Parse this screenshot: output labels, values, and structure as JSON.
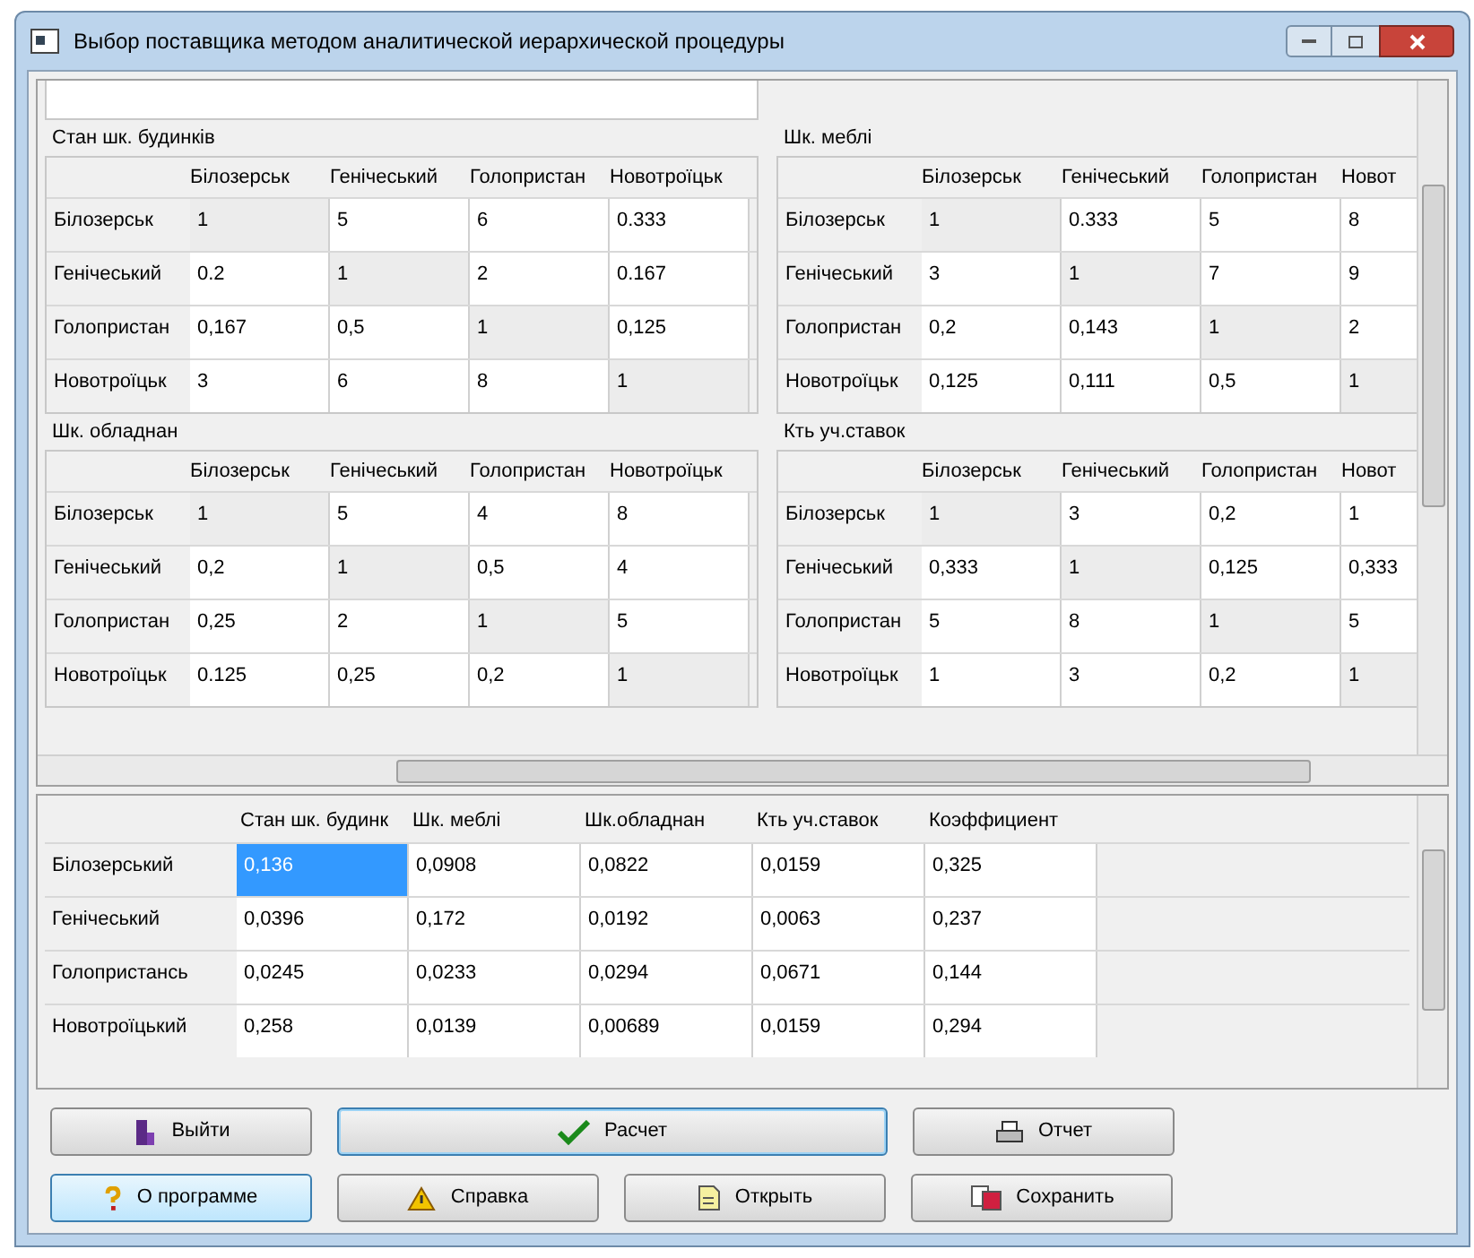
{
  "window": {
    "title": "Выбор поставщика методом аналитической иерархической процедуры"
  },
  "matrices": [
    {
      "title": "Стан шк. будинків",
      "columns": [
        "Білозерськ",
        "Генічеський",
        "Голопристан",
        "Новотроїцьк"
      ],
      "rows": [
        {
          "label": "Білозерськ",
          "cells": [
            "1",
            "5",
            "6",
            "0.333"
          ]
        },
        {
          "label": "Генічеський",
          "cells": [
            "0.2",
            "1",
            "2",
            "0.167"
          ]
        },
        {
          "label": "Голопристан",
          "cells": [
            "0,167",
            "0,5",
            "1",
            "0,125"
          ]
        },
        {
          "label": "Новотроїцьк",
          "cells": [
            "3",
            "6",
            "8",
            "1"
          ]
        }
      ]
    },
    {
      "title": "Шк. меблі",
      "columns": [
        "Білозерськ",
        "Генічеський",
        "Голопристан",
        "Новот"
      ],
      "rows": [
        {
          "label": "Білозерськ",
          "cells": [
            "1",
            "0.333",
            "5",
            "8"
          ]
        },
        {
          "label": "Генічеський",
          "cells": [
            "3",
            "1",
            "7",
            "9"
          ]
        },
        {
          "label": "Голопристан",
          "cells": [
            "0,2",
            "0,143",
            "1",
            "2"
          ]
        },
        {
          "label": "Новотроїцьк",
          "cells": [
            "0,125",
            "0,111",
            "0,5",
            "1"
          ]
        }
      ]
    },
    {
      "title": "Шк. обладнан",
      "columns": [
        "Білозерськ",
        "Генічеський",
        "Голопристан",
        "Новотроїцьк"
      ],
      "rows": [
        {
          "label": "Білозерськ",
          "cells": [
            "1",
            "5",
            "4",
            "8"
          ]
        },
        {
          "label": "Генічеський",
          "cells": [
            "0,2",
            "1",
            "0,5",
            "4"
          ]
        },
        {
          "label": "Голопристан",
          "cells": [
            "0,25",
            "2",
            "1",
            "5"
          ]
        },
        {
          "label": "Новотроїцьк",
          "cells": [
            "0.125",
            "0,25",
            "0,2",
            "1"
          ]
        }
      ]
    },
    {
      "title": "Кть уч.ставок",
      "columns": [
        "Білозерськ",
        "Генічеський",
        "Голопристан",
        "Новот"
      ],
      "rows": [
        {
          "label": "Білозерськ",
          "cells": [
            "1",
            "3",
            "0,2",
            "1"
          ]
        },
        {
          "label": "Генічеський",
          "cells": [
            "0,333",
            "1",
            "0,125",
            "0,333"
          ]
        },
        {
          "label": "Голопристан",
          "cells": [
            "5",
            "8",
            "1",
            "5"
          ]
        },
        {
          "label": "Новотроїцьк",
          "cells": [
            "1",
            "3",
            "0,2",
            "1"
          ]
        }
      ]
    }
  ],
  "results": {
    "columns": [
      "Стан шк. будинк",
      "Шк. меблі",
      "Шк.обладнан",
      "Кть уч.ставок",
      "Коэффициент"
    ],
    "rows": [
      {
        "label": "Білозерський",
        "cells": [
          {
            "text": "0,136",
            "selected": true
          },
          {
            "text": "0,0908",
            "selected": false
          },
          {
            "text": "0,0822",
            "selected": false
          },
          {
            "text": "0,0159",
            "selected": false
          },
          {
            "text": "0,325",
            "selected": false
          }
        ]
      },
      {
        "label": "Генічеський",
        "cells": [
          {
            "text": "0,0396",
            "selected": false
          },
          {
            "text": "0,172",
            "selected": false
          },
          {
            "text": "0,0192",
            "selected": false
          },
          {
            "text": "0,0063",
            "selected": false
          },
          {
            "text": "0,237",
            "selected": false
          }
        ]
      },
      {
        "label": "Голопристансь",
        "cells": [
          {
            "text": "0,0245",
            "selected": false
          },
          {
            "text": "0,0233",
            "selected": false
          },
          {
            "text": "0,0294",
            "selected": false
          },
          {
            "text": "0,0671",
            "selected": false
          },
          {
            "text": "0,144",
            "selected": false
          }
        ]
      },
      {
        "label": "Новотроїцький",
        "cells": [
          {
            "text": "0,258",
            "selected": false
          },
          {
            "text": "0,0139",
            "selected": false
          },
          {
            "text": "0,00689",
            "selected": false
          },
          {
            "text": "0,0159",
            "selected": false
          },
          {
            "text": "0,294",
            "selected": false
          }
        ]
      }
    ]
  },
  "buttons": [
    [
      {
        "label": "Выйти",
        "kind": "exit",
        "focused": false,
        "highlighted": false
      },
      {
        "label": "Расчет",
        "kind": "calculate",
        "focused": true,
        "highlighted": false
      },
      {
        "label": "Отчет",
        "kind": "report",
        "focused": false,
        "highlighted": false
      }
    ],
    [
      {
        "label": "О программе",
        "kind": "about",
        "focused": false,
        "highlighted": true
      },
      {
        "label": "Справка",
        "kind": "help",
        "focused": false,
        "highlighted": false
      },
      {
        "label": "Открыть",
        "kind": "open",
        "focused": false,
        "highlighted": false
      },
      {
        "label": "Сохранить",
        "kind": "save",
        "focused": false,
        "highlighted": false
      }
    ]
  ]
}
